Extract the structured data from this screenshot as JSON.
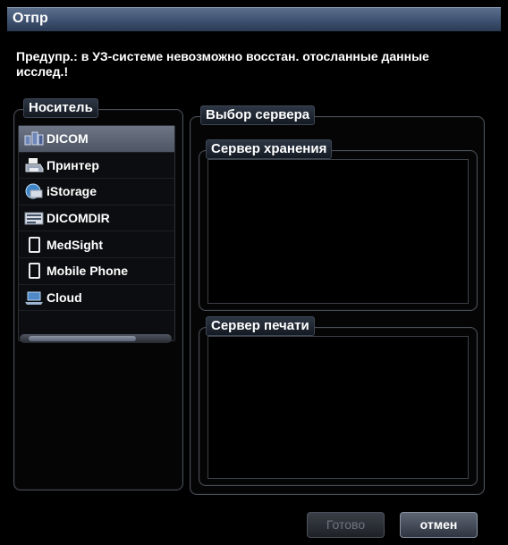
{
  "window": {
    "title": "Отпр"
  },
  "warning": "Предупр.: в УЗ-системе невозможно восстан. отосланные данные исслед.!",
  "media": {
    "legend": "Носитель",
    "items": [
      {
        "label": "DICOM",
        "icon": "dicom-network-icon",
        "selected": true
      },
      {
        "label": "Принтер",
        "icon": "printer-icon"
      },
      {
        "label": "iStorage",
        "icon": "istorage-icon"
      },
      {
        "label": "DICOMDIR",
        "icon": "dicomdir-icon"
      },
      {
        "label": "MedSight",
        "icon": "mobile-device-icon"
      },
      {
        "label": "Mobile Phone",
        "icon": "mobile-phone-icon"
      },
      {
        "label": "Cloud",
        "icon": "cloud-laptop-icon"
      }
    ]
  },
  "server_select": {
    "legend": "Выбор сервера",
    "storage_legend": "Сервер хранения",
    "print_legend": "Сервер печати"
  },
  "buttons": {
    "done": "Готово",
    "cancel": "отмен"
  }
}
